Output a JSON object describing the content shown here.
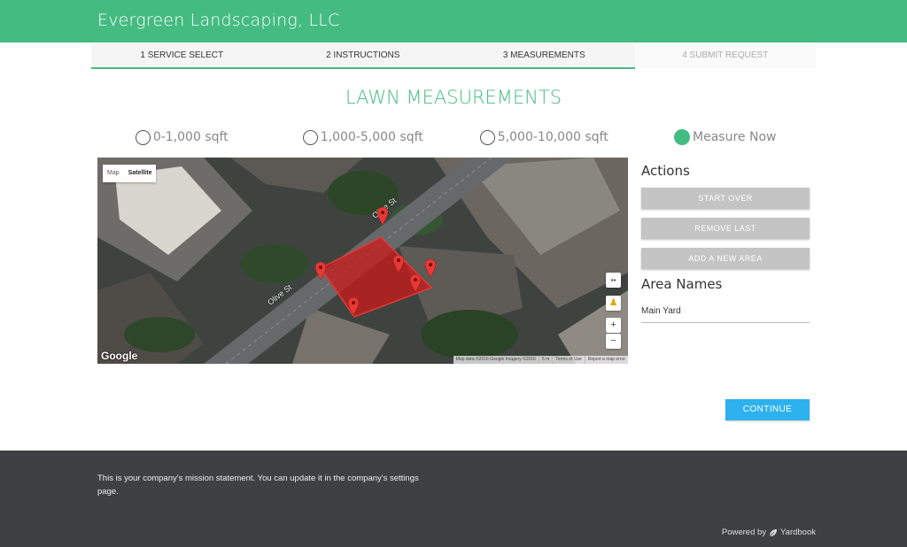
{
  "header": {
    "brand": "Evergreen Landscaping, LLC"
  },
  "steps": [
    {
      "label": "1 SERVICE SELECT",
      "state": "done"
    },
    {
      "label": "2 INSTRUCTIONS",
      "state": "done"
    },
    {
      "label": "3 MEASUREMENTS",
      "state": "current"
    },
    {
      "label": "4 SUBMIT REQUEST",
      "state": "disabled"
    }
  ],
  "page_title": "LAWN MEASUREMENTS",
  "size_options": [
    {
      "label": "0-1,000 sqft",
      "selected": false
    },
    {
      "label": "1,000-5,000 sqft",
      "selected": false
    },
    {
      "label": "5,000-10,000 sqft",
      "selected": false
    },
    {
      "label": "Measure Now",
      "selected": true
    }
  ],
  "map": {
    "type_map": "Map",
    "type_satellite": "Satellite",
    "street_1": "Olive St",
    "street_2": "Olive St",
    "google": "Google",
    "attribution": "Map data ©2016 Google Imagery ©2016",
    "scale": "5 m",
    "terms": "Terms of Use",
    "report": "Report a map error",
    "zoom_in": "+",
    "zoom_out": "−",
    "polygon_color": "#cc1a1a",
    "marker_color": "#e53935"
  },
  "actions": {
    "title": "Actions",
    "start_over": "START OVER",
    "remove_last": "REMOVE LAST",
    "add_area": "ADD A NEW AREA"
  },
  "areas": {
    "title": "Area Names",
    "items": [
      "Main Yard"
    ]
  },
  "continue_label": "CONTINUE",
  "footer": {
    "mission": "This is your company's mission statement. You can update it in the company's settings page.",
    "powered_by": "Powered by",
    "powered_brand": "Yardbook"
  },
  "colors": {
    "accent": "#44bb80",
    "primary_button": "#2db1ef",
    "footer_bg": "#3e4044"
  }
}
